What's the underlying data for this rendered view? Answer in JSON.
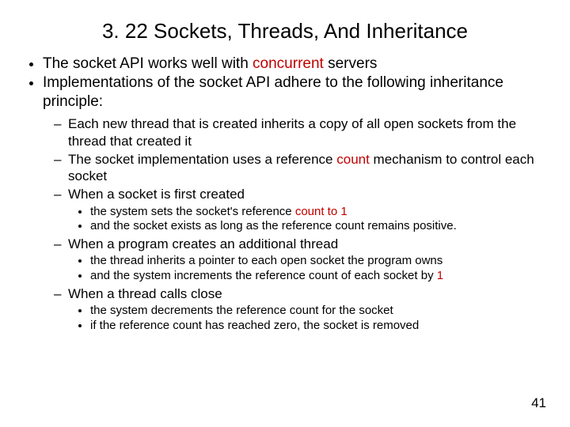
{
  "title": "3. 22  Sockets, Threads, And Inheritance",
  "b1": {
    "pre": "The socket API works well with ",
    "hl": "concurrent",
    "post": " servers"
  },
  "b2": "Implementations of the socket API adhere to the following inheritance principle:",
  "s1": "Each new thread that is created inherits a copy of all open sockets from the thread that created it",
  "s2": {
    "pre": "The socket implementation uses a reference ",
    "hl": "count",
    "post": " mechanism to control each socket"
  },
  "s3": "When a socket is first created",
  "s3a": {
    "pre": "the system sets the socket's reference ",
    "hl": "count to 1"
  },
  "s3b": "and the socket exists as long as the reference count remains positive.",
  "s4": "When a program creates an additional thread",
  "s4a": "the thread inherits a pointer to each open socket the program owns",
  "s4b": {
    "pre": "and the system increments the reference count of each socket by ",
    "hl": "1"
  },
  "s5": "When a thread calls close",
  "s5a": "the system decrements the reference count for the socket",
  "s5b": "if the reference count has reached zero, the socket is removed",
  "page": "41"
}
